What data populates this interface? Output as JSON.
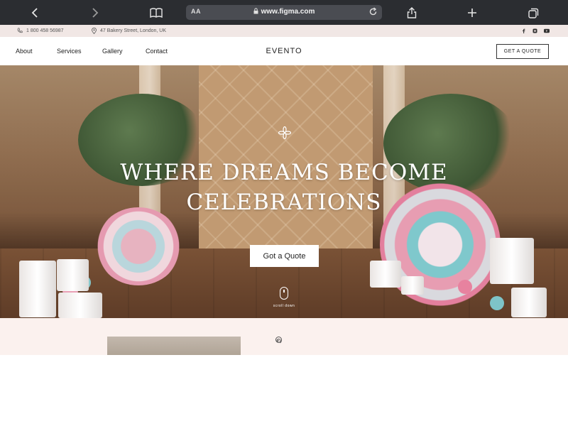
{
  "browser": {
    "url_aa": "AA",
    "url": "www.figma.com"
  },
  "info_bar": {
    "phone": "1 800 458 56987",
    "address": "47 Bakery Street, London, UK",
    "social_icons": [
      "facebook-icon",
      "instagram-icon",
      "youtube-icon"
    ]
  },
  "nav": {
    "links": [
      "About",
      "Services",
      "Gallery",
      "Contact"
    ],
    "brand": "EVENTO",
    "quote_button": "GET A QUOTE"
  },
  "hero": {
    "title_line1": "WHERE DREAMS BECOME",
    "title_line2": "CELEBRATIONS",
    "cta": "Got a Quote",
    "scroll_label": "scroll down"
  },
  "colors": {
    "chrome": "#2b2d31",
    "info_bar_bg": "#f1e7e5",
    "section_bg": "#fbf1ee",
    "text_dark": "#222222"
  }
}
